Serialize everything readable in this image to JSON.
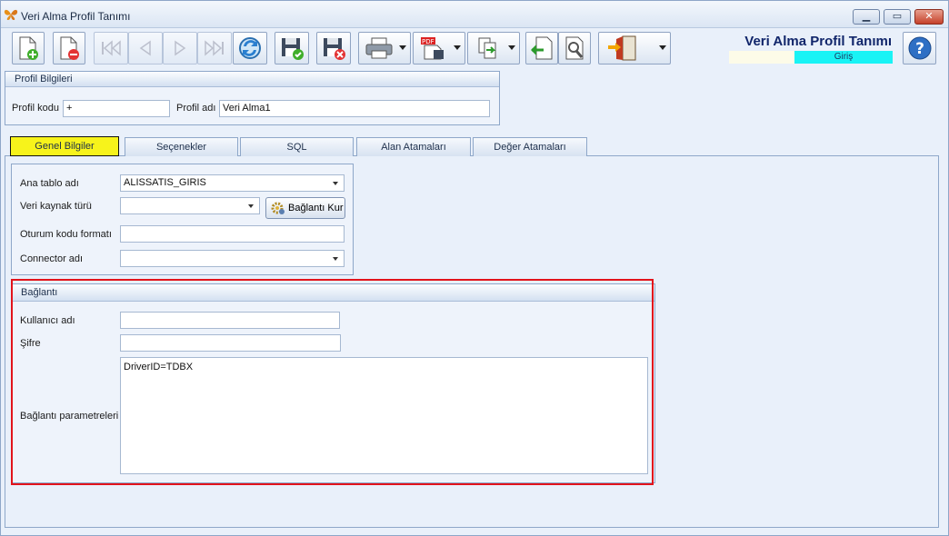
{
  "window": {
    "title": "Veri Alma Profil Tanımı",
    "controls": {
      "minimize": "▁",
      "maximize": "▭",
      "close": "✕"
    }
  },
  "toolbar": {
    "icons": [
      "new-document-icon",
      "delete-document-icon",
      "first-record-icon",
      "previous-record-icon",
      "next-record-icon",
      "last-record-icon",
      "refresh-icon",
      "save-icon",
      "save-close-icon",
      "print-icon",
      "export-pdf-icon",
      "copy-icon",
      "import-icon",
      "tools-icon",
      "exit-icon"
    ]
  },
  "header": {
    "form_title": "Veri Alma Profil Tanımı",
    "mode": "Giriş"
  },
  "profile": {
    "group_title": "Profil Bilgileri",
    "code_label": "Profil kodu",
    "code_value": "+",
    "name_label": "Profil adı",
    "name_value": "Veri Alma1"
  },
  "tabs": [
    {
      "label": "Genel Bilgiler",
      "active": true
    },
    {
      "label": "Seçenekler"
    },
    {
      "label": "SQL"
    },
    {
      "label": "Alan Atamaları"
    },
    {
      "label": "Değer Atamaları"
    }
  ],
  "general": {
    "main_table_label": "Ana tablo adı",
    "main_table_value": "ALISSATIS_GIRIS",
    "source_type_label": "Veri kaynak türü",
    "source_type_value": "",
    "connect_button": "Bağlantı Kur",
    "session_format_label": "Oturum kodu formatı",
    "session_format_value": "",
    "connector_label": "Connector adı",
    "connector_value": ""
  },
  "connection": {
    "group_title": "Bağlantı",
    "user_label": "Kullanıcı adı",
    "user_value": "",
    "password_label": "Şifre",
    "password_value": "",
    "params_label": "Bağlantı parametreleri",
    "params_value": "DriverID=TDBX"
  },
  "colors": {
    "active_tab": "#f7f31b",
    "mode_badge": "#19f3f5",
    "highlight_frame": "#e2131b",
    "title_blue": "#10256a"
  }
}
